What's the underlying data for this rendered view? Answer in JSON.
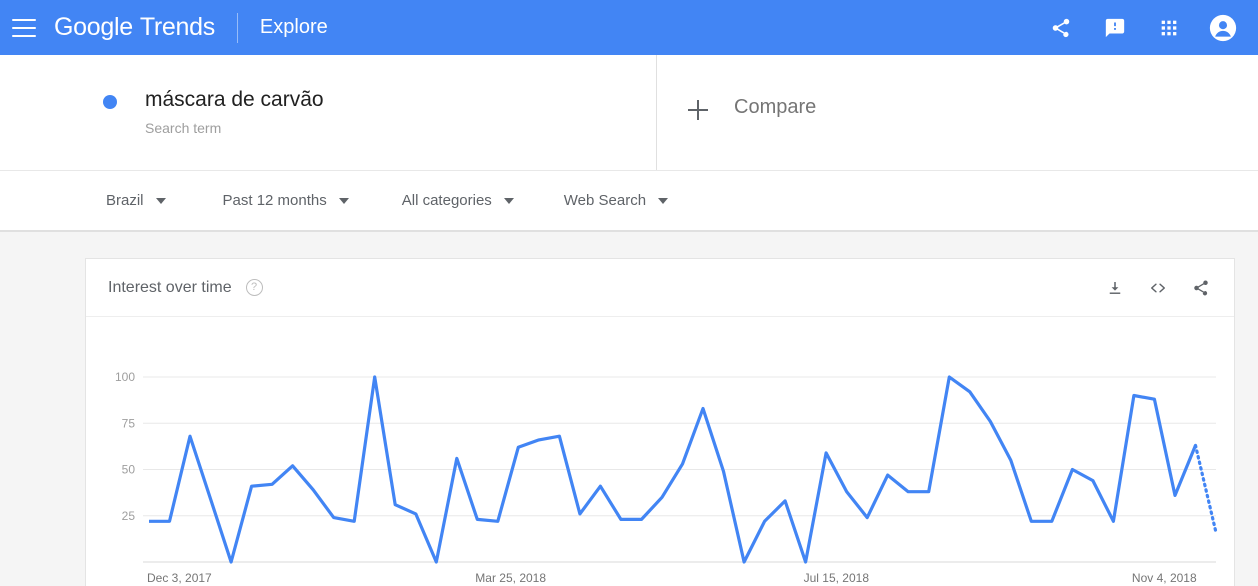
{
  "appbar": {
    "menu_icon": "hamburger-menu-icon",
    "brand_google": "Google",
    "brand_product": "Trends",
    "explore_label": "Explore",
    "icons": [
      "share-icon",
      "feedback-icon",
      "apps-grid-icon",
      "account-avatar-icon"
    ],
    "background_color": "#4285f4"
  },
  "search_term": {
    "dot_color": "#4285f4",
    "title": "máscara de carvão",
    "subtitle": "Search term"
  },
  "compare": {
    "plus_icon": "plus-icon",
    "label": "Compare"
  },
  "filters": [
    {
      "label": "Brazil"
    },
    {
      "label": "Past 12 months"
    },
    {
      "label": "All categories"
    },
    {
      "label": "Web Search"
    }
  ],
  "card": {
    "title": "Interest over time",
    "help_glyph": "?",
    "actions": [
      {
        "name": "download-csv-button"
      },
      {
        "name": "embed-code-button"
      },
      {
        "name": "share-chart-button"
      }
    ]
  },
  "chart_data": {
    "type": "line",
    "title": "Interest over time",
    "xlabel": "",
    "ylabel": "",
    "ylim": [
      0,
      100
    ],
    "grid": true,
    "legend": false,
    "line_color": "#4285f4",
    "ytick_labels": [
      "100",
      "75",
      "50",
      "25"
    ],
    "ytick_values": [
      100,
      75,
      50,
      25
    ],
    "xtick_labels": [
      "Dec 3, 2017",
      "Mar 25, 2018",
      "Jul 15, 2018",
      "Nov 4, 2018"
    ],
    "xtick_indices": [
      0,
      16,
      32,
      48
    ],
    "series": [
      {
        "name": "máscara de carvão",
        "values": [
          22,
          22,
          68,
          34,
          0,
          41,
          42,
          52,
          39,
          24,
          22,
          100,
          31,
          26,
          0,
          56,
          23,
          22,
          62,
          66,
          68,
          26,
          41,
          23,
          23,
          35,
          53,
          83,
          49,
          0,
          22,
          33,
          0,
          59,
          38,
          24,
          47,
          38,
          38,
          100,
          92,
          76,
          55,
          22,
          22,
          50,
          44,
          22,
          90,
          88,
          36,
          63,
          16
        ],
        "partial_from_index": 51
      }
    ],
    "notes": "Final segment rendered as dotted line indicating incomplete/partial data"
  }
}
